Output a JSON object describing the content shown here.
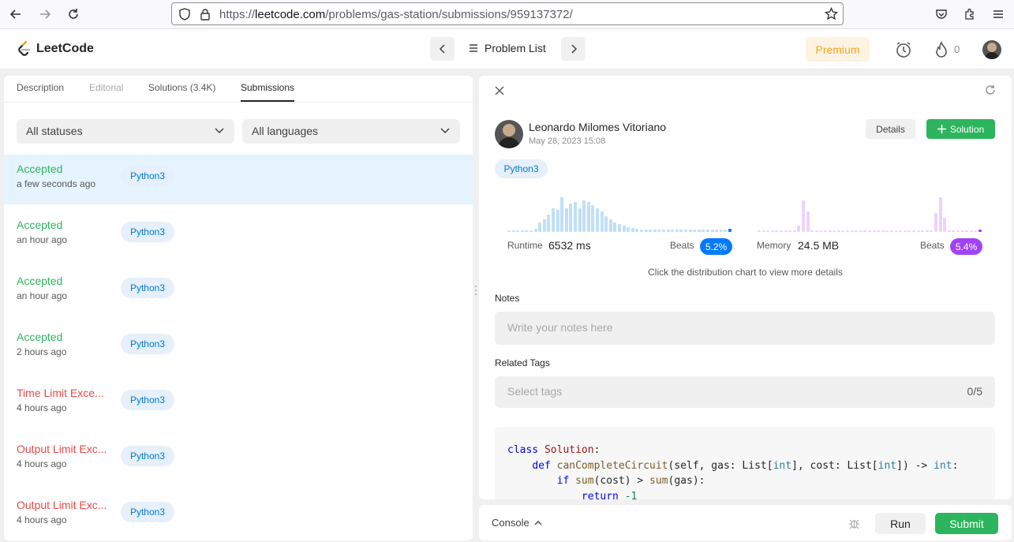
{
  "browser": {
    "url_prefix": "https://",
    "url_domain": "leetcode.com",
    "url_path": "/problems/gas-station/submissions/959137372/"
  },
  "header": {
    "logo_text": "LeetCode",
    "problem_list_label": "Problem List",
    "premium_label": "Premium",
    "streak_count": "0"
  },
  "left_panel": {
    "tabs": [
      {
        "label": "Description"
      },
      {
        "label": "Editorial"
      },
      {
        "label": "Solutions (3.4K)"
      },
      {
        "label": "Submissions"
      }
    ],
    "status_filter": "All statuses",
    "language_filter": "All languages",
    "submissions": [
      {
        "status": "Accepted",
        "time": "a few seconds ago",
        "lang": "Python3"
      },
      {
        "status": "Accepted",
        "time": "an hour ago",
        "lang": "Python3"
      },
      {
        "status": "Accepted",
        "time": "an hour ago",
        "lang": "Python3"
      },
      {
        "status": "Accepted",
        "time": "2 hours ago",
        "lang": "Python3"
      },
      {
        "status": "Time Limit Exce...",
        "time": "4 hours ago",
        "lang": "Python3"
      },
      {
        "status": "Output Limit Exc...",
        "time": "4 hours ago",
        "lang": "Python3"
      },
      {
        "status": "Output Limit Exc...",
        "time": "4 hours ago",
        "lang": "Python3"
      }
    ]
  },
  "right_panel": {
    "user_name": "Leonardo Milomes Vitoriano",
    "date": "May 28, 2023 15:08",
    "details_label": "Details",
    "solution_label": "Solution",
    "language": "Python3",
    "runtime_label": "Runtime",
    "runtime_value": "6532 ms",
    "runtime_beats_label": "Beats",
    "runtime_beats": "5.2%",
    "memory_label": "Memory",
    "memory_value": "24.5 MB",
    "memory_beats_label": "Beats",
    "memory_beats": "5.4%",
    "chart_hint": "Click the distribution chart to view more details",
    "notes_label": "Notes",
    "notes_placeholder": "Write your notes here",
    "tags_label": "Related Tags",
    "tags_placeholder": "Select tags",
    "tags_count": "0/5",
    "code_lines": [
      "class Solution:",
      "    def canCompleteCircuit(self, gas: List[int], cost: List[int]) -> int:",
      "        if sum(cost) > sum(gas):",
      "            return -1"
    ]
  },
  "console": {
    "console_label": "Console",
    "run_label": "Run",
    "submit_label": "Submit"
  },
  "colors": {
    "accepted": "#2db55d",
    "error": "#ef4743",
    "runtime_accent": "#007aff",
    "memory_accent": "#a142f4",
    "premium": "#ffa116"
  }
}
